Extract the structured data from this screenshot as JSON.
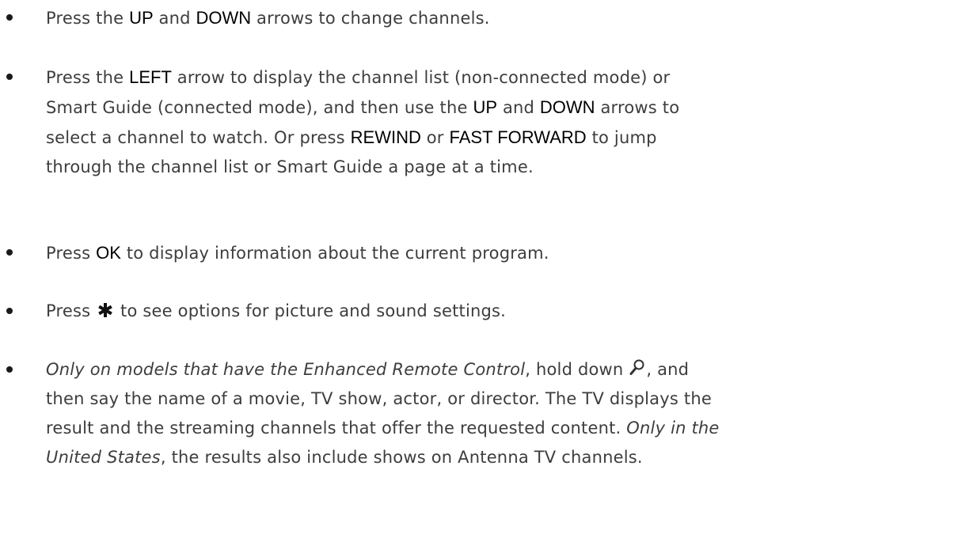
{
  "bullets": [
    {
      "lines": [
        [
          {
            "t": "Press the "
          },
          {
            "t": "UP",
            "k": 1
          },
          {
            "t": " and "
          },
          {
            "t": "DOWN",
            "k": 1
          },
          {
            "t": " arrows to change channels."
          }
        ]
      ]
    },
    {
      "lines": [
        [
          {
            "t": "Press the "
          },
          {
            "t": "LEFT",
            "k": 1
          },
          {
            "t": " arrow to display the channel list (non-connected mode) or"
          }
        ],
        [
          {
            "t": "Smart Guide (connected mode), and then use the "
          },
          {
            "t": "UP",
            "k": 1
          },
          {
            "t": " and "
          },
          {
            "t": "DOWN",
            "k": 1
          },
          {
            "t": " arrows to"
          }
        ],
        [
          {
            "t": "select a channel to watch. Or press "
          },
          {
            "t": "REWIND",
            "k": 1
          },
          {
            "t": " or "
          },
          {
            "t": "FAST FORWARD",
            "k": 1
          },
          {
            "t": " to jump"
          }
        ],
        [
          {
            "t": "through the channel list or Smart Guide a page at a time."
          }
        ]
      ]
    },
    {
      "lines": [
        [
          {
            "t": "Press "
          },
          {
            "t": "OK",
            "k": 1
          },
          {
            "t": " to display information about the current program."
          }
        ]
      ]
    },
    {
      "lines": [
        [
          {
            "t": "Press "
          },
          {
            "icon": "star-icon"
          },
          {
            "t": " to see options for picture and sound settings."
          }
        ]
      ]
    },
    {
      "lines": [
        [
          {
            "t": "Only on models that have the Enhanced Remote Control",
            "i": 1
          },
          {
            "t": ", hold down "
          },
          {
            "icon": "search-icon"
          },
          {
            "t": ", and"
          }
        ],
        [
          {
            "t": "then say the name of a movie, TV show, actor, or director. The TV displays the"
          }
        ],
        [
          {
            "t": "result and the streaming channels that offer the requested content. "
          },
          {
            "t": "Only in the",
            "i": 1
          }
        ],
        [
          {
            "t": "United States",
            "i": 1
          },
          {
            "t": ", the results also include shows on Antenna TV channels."
          }
        ]
      ]
    }
  ]
}
